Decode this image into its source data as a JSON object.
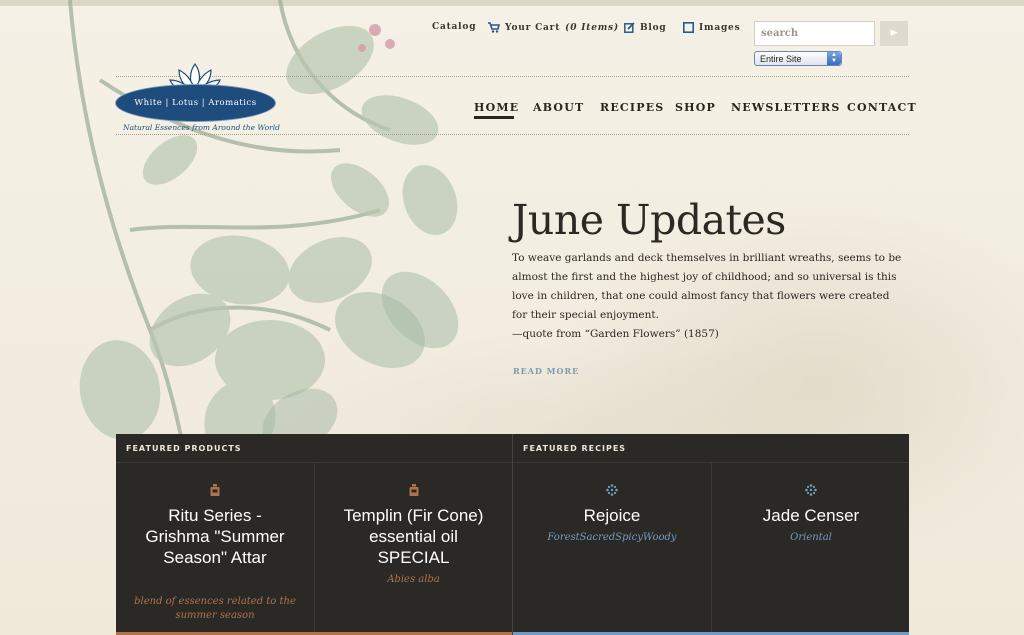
{
  "utility_nav": {
    "catalog": "Catalog",
    "cart_label": "Your Cart",
    "cart_count": "(0 Items)",
    "blog": "Blog",
    "images": "Images"
  },
  "search": {
    "placeholder": "search",
    "button": "▶",
    "scope": "Entire Site"
  },
  "logo": {
    "name": "White | Lotus | Aromatics",
    "tagline": "Natural Essences from Around the World"
  },
  "main_nav": [
    "HOME",
    "ABOUT",
    "RECIPES",
    "SHOP",
    "NEWSLETTERS",
    "CONTACT"
  ],
  "hero": {
    "title": "June Updates",
    "body": "To weave garlands and deck themselves in brilliant wreaths, seems to be almost the first and the highest joy of childhood; and so universal is this love in children, that one could almost fancy that flowers were created for their special enjoyment.",
    "quote": "—quote from “Garden Flowers” (1857)",
    "read_more": "READ MORE"
  },
  "featured_products": {
    "heading": "FEATURED PRODUCTS",
    "items": [
      {
        "title": "Ritu Series - Grishma \"Summer Season\" Attar",
        "subtitle": "blend of essences related to the summer season",
        "icon": "bottle-icon"
      },
      {
        "title": "Templin (Fir Cone) essential oil SPECIAL",
        "subtitle": "Abies alba",
        "icon": "bottle-icon"
      }
    ]
  },
  "featured_recipes": {
    "heading": "FEATURED RECIPES",
    "items": [
      {
        "title": "Rejoice",
        "subtitle": "ForestSacredSpicyWoody",
        "icon": "snowflake-icon"
      },
      {
        "title": "Jade Censer",
        "subtitle": "Oriental",
        "icon": "snowflake-icon"
      }
    ]
  },
  "colors": {
    "brand_blue": "#1e4c7c",
    "panel": "#2b2925",
    "accent_orange": "#b2724a",
    "accent_blue": "#6f9cc4"
  }
}
